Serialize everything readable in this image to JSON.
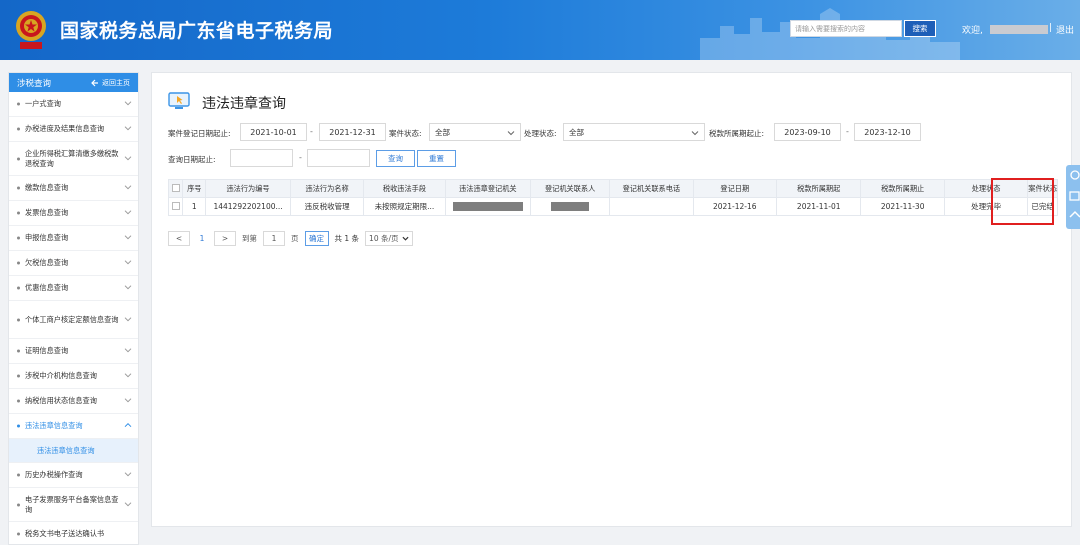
{
  "header": {
    "emblem_text": "中国税务",
    "title": "国家税务总局广东省电子税务局",
    "search_placeholder": "请输入需要搜索的内容",
    "search_button": "搜索",
    "welcome": "欢迎,",
    "pipe": "|",
    "logout": "退出"
  },
  "sidebar": {
    "title": "涉税查询",
    "back": "返回主页",
    "items": [
      {
        "label": "一户式查询"
      },
      {
        "label": "办税进度及结果信息查询"
      },
      {
        "label": "企业所得税汇算清缴多缴税款退税查询"
      },
      {
        "label": "缴款信息查询"
      },
      {
        "label": "发票信息查询"
      },
      {
        "label": "申报信息查询"
      },
      {
        "label": "欠税信息查询"
      },
      {
        "label": "优惠信息查询"
      },
      {
        "label": "个体工商户核定定额信息查询"
      },
      {
        "label": "证明信息查询"
      },
      {
        "label": "涉税中介机构信息查询"
      },
      {
        "label": "纳税信用状态信息查询"
      },
      {
        "label": "违法违章信息查询"
      },
      {
        "label": "历史办税操作查询"
      },
      {
        "label": "电子发票服务平台备案信息查询"
      },
      {
        "label": "税务文书电子送达确认书"
      }
    ],
    "sub_item": "违法违章信息查询"
  },
  "page": {
    "title": "违法违章查询"
  },
  "filters": {
    "reg_date_label": "案件登记日期起止:",
    "reg_date_start": "2021-10-01",
    "reg_date_end": "2021-12-31",
    "dash": "-",
    "case_status_label": "案件状态:",
    "case_status_value": "全部",
    "handle_status_label": "处理状态:",
    "handle_status_value": "全部",
    "tax_period_label": "税款所属期起止:",
    "tax_period_start": "2023-09-10",
    "tax_period_end": "2023-12-10",
    "query_date_label": "查询日期起止:",
    "query_button": "查询",
    "reset_button": "重置"
  },
  "table": {
    "headers": [
      "序号",
      "违法行为编号",
      "违法行为名称",
      "税收违法手段",
      "违法违章登记机关",
      "登记机关联系人",
      "登记机关联系电话",
      "登记日期",
      "税款所属期起",
      "税款所属期止",
      "处理状态",
      "案件状态"
    ],
    "rows": [
      {
        "index": "1",
        "code": "1441292202100...",
        "name": "违反税收管理",
        "means": "未按照规定期限...",
        "phone": "",
        "reg_date": "2021-12-16",
        "period_start": "2021-11-01",
        "period_end": "2021-11-30",
        "handle_status": "处理完毕",
        "case_status": "已完结"
      }
    ]
  },
  "pager": {
    "prev": "<",
    "current_page": "1",
    "next": ">",
    "goto_label": "到第",
    "goto_value": "1",
    "page_unit": "页",
    "confirm": "确定",
    "total": "共 1 条",
    "page_size": "10 条/页"
  }
}
